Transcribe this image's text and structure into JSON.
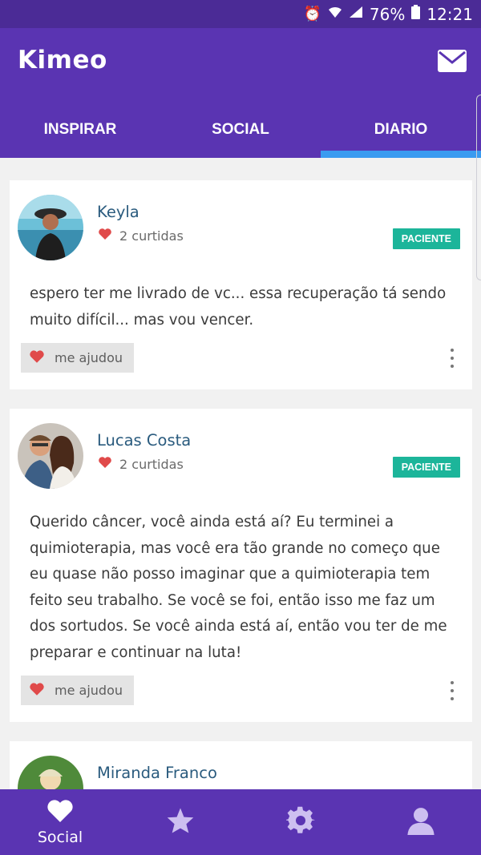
{
  "status": {
    "battery": "76%",
    "time": "12:21"
  },
  "app": {
    "title": "Kimeo"
  },
  "tabs": [
    {
      "label": "INSPIRAR",
      "active": false
    },
    {
      "label": "SOCIAL",
      "active": false
    },
    {
      "label": "DIARIO",
      "active": true
    }
  ],
  "posts": [
    {
      "name": "Keyla",
      "likes": "2 curtidas",
      "badge": "PACIENTE",
      "text": "espero ter me livrado de vc... essa recuperação tá sendo muito difícil... mas vou vencer.",
      "help_label": "me ajudou"
    },
    {
      "name": "Lucas Costa",
      "likes": "2 curtidas",
      "badge": "PACIENTE",
      "text": "Querido câncer, você ainda está aí? Eu terminei a quimioterapia, mas você era tão grande no começo que eu quase não posso imaginar que a quimioterapia tem feito seu trabalho. Se você se foi, então isso me faz um dos sortudos. Se você ainda está aí, então vou ter de me preparar e continuar na luta!",
      "help_label": "me ajudou"
    },
    {
      "name": "Miranda Franco"
    }
  ],
  "bottom_nav": [
    {
      "label": "Social",
      "icon": "heart-icon",
      "active": true
    },
    {
      "label": "",
      "icon": "star-icon",
      "active": false
    },
    {
      "label": "",
      "icon": "gear-icon",
      "active": false
    },
    {
      "label": "",
      "icon": "user-icon",
      "active": false
    }
  ],
  "colors": {
    "primary": "#5a34b2",
    "status_bar": "#4b2b96",
    "tab_indicator": "#3a9bf0",
    "badge": "#1cb59a",
    "heart": "#e04a4a",
    "name": "#2a5b7e"
  }
}
